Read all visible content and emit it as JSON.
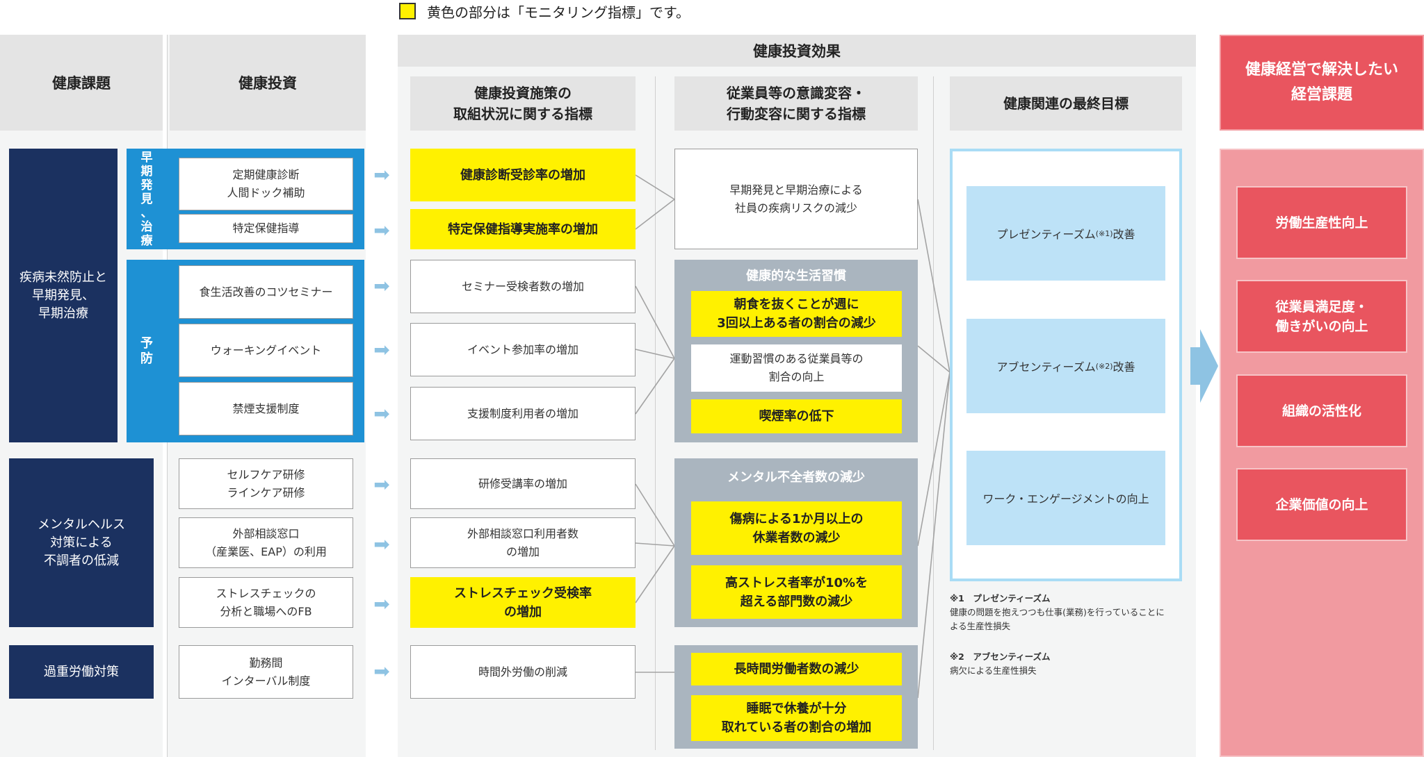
{
  "legend": {
    "text": "黄色の部分は「モニタリング指標」です。",
    "swatch_color": "#fff100"
  },
  "headers": {
    "issue": "健康課題",
    "investment": "健康投資",
    "effect": "健康投資効果",
    "measures": "健康投資施策の\n取組状況に関する指標",
    "behavior": "従業員等の意識変容・\n行動変容に関する指標",
    "final": "健康関連の最終目標",
    "management": "健康経営で解決したい\n経営課題"
  },
  "issues": [
    "疾病未然防止と\n早期発見、\n早期治療",
    "メンタルヘルス\n対策による\n不調者の低減",
    "過重労働対策"
  ],
  "category_labels": {
    "early": "早\n期\n発\n見\n、\n治\n療",
    "prevention": "予\n防"
  },
  "investments": [
    "定期健康診断\n人間ドック補助",
    "特定保健指導",
    "食生活改善のコツセミナー",
    "ウォーキングイベント",
    "禁煙支援制度",
    "セルフケア研修\nラインケア研修",
    "外部相談窓口\n（産業医、EAP）の利用",
    "ストレスチェックの\n分析と職場へのFB",
    "勤務間\nインターバル制度"
  ],
  "arrow_glyph": "➡",
  "measures": [
    "健康診断受診率の増加",
    "特定保健指導実施率の増加",
    "セミナー受検者数の増加",
    "イベント参加率の増加",
    "支援制度利用者の増加",
    "研修受講率の増加",
    "外部相談窓口利用者数\nの増加",
    "ストレスチェック受検率\nの増加",
    "時間外労働の削減"
  ],
  "behavior": {
    "early_box": "早期発見と早期治療による\n社員の疾病リスクの減少",
    "lifestyle": {
      "title": "健康的な生活習慣",
      "items": [
        "朝食を抜くことが週に\n3回以上ある者の割合の減少",
        "運動習慣のある従業員等の\n割合の向上",
        "喫煙率の低下"
      ]
    },
    "mental": {
      "title": "メンタル不全者数の減少",
      "items": [
        "傷病による1か月以上の\n休業者数の減少",
        "高ストレス者率が10%を\n超える部門数の減少"
      ]
    },
    "overwork": {
      "items": [
        "長時間労働者数の減少",
        "睡眠で休養が十分\n取れている者の割合の増加"
      ]
    }
  },
  "final_goals": [
    {
      "pre": "プレゼンティーズム",
      "sup": "(※1)",
      "post": "改善"
    },
    {
      "pre": "アブセンティーズム",
      "sup": "(※2)",
      "post": "改善"
    },
    {
      "pre": "ワーク・エンゲージメントの向上",
      "sup": "",
      "post": ""
    }
  ],
  "notes": [
    {
      "title": "※1　プレゼンティーズム",
      "body": "健康の問題を抱えつつも仕事(業務)を行っていることに\nよる生産性損失"
    },
    {
      "title": "※2　アブセンティーズム",
      "body": "病欠による生産性損失"
    }
  ],
  "management_goals": [
    "労働生産性向上",
    "従業員満足度・\n働きがいの向上",
    "組織の活性化",
    "企業価値の向上"
  ]
}
